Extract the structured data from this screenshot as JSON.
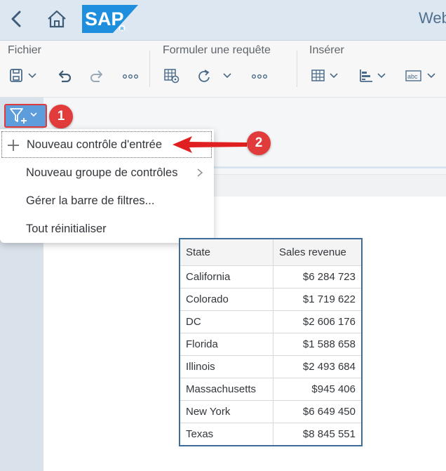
{
  "shell": {
    "title": "Web",
    "logo_text": "SAP"
  },
  "toolbar": {
    "groups": [
      {
        "title": "Fichier"
      },
      {
        "title": "Formuler une requête"
      },
      {
        "title": "Insérer"
      }
    ]
  },
  "markers": [
    "1",
    "2"
  ],
  "menu": {
    "items": [
      {
        "label": "Nouveau contrôle d'entrée"
      },
      {
        "label": "Nouveau groupe de contrôles"
      },
      {
        "label": "Gérer la barre de filtres..."
      },
      {
        "label": "Tout réinitialiser"
      }
    ]
  },
  "table": {
    "headers": [
      "State",
      "Sales revenue"
    ],
    "rows": [
      [
        "California",
        "$6 284 723"
      ],
      [
        "Colorado",
        "$1 719 622"
      ],
      [
        "DC",
        "$2 606 176"
      ],
      [
        "Florida",
        "$1 588 658"
      ],
      [
        "Illinois",
        "$2 493 684"
      ],
      [
        "Massachusetts",
        "$945 406"
      ],
      [
        "New York",
        "$6 649 450"
      ],
      [
        "Texas",
        "$8 845 551"
      ]
    ]
  },
  "colors": {
    "accent": "#5d9ddc",
    "marker": "#e13b3b",
    "shell": "#dde7f2",
    "table_border": "#3f6d99"
  }
}
